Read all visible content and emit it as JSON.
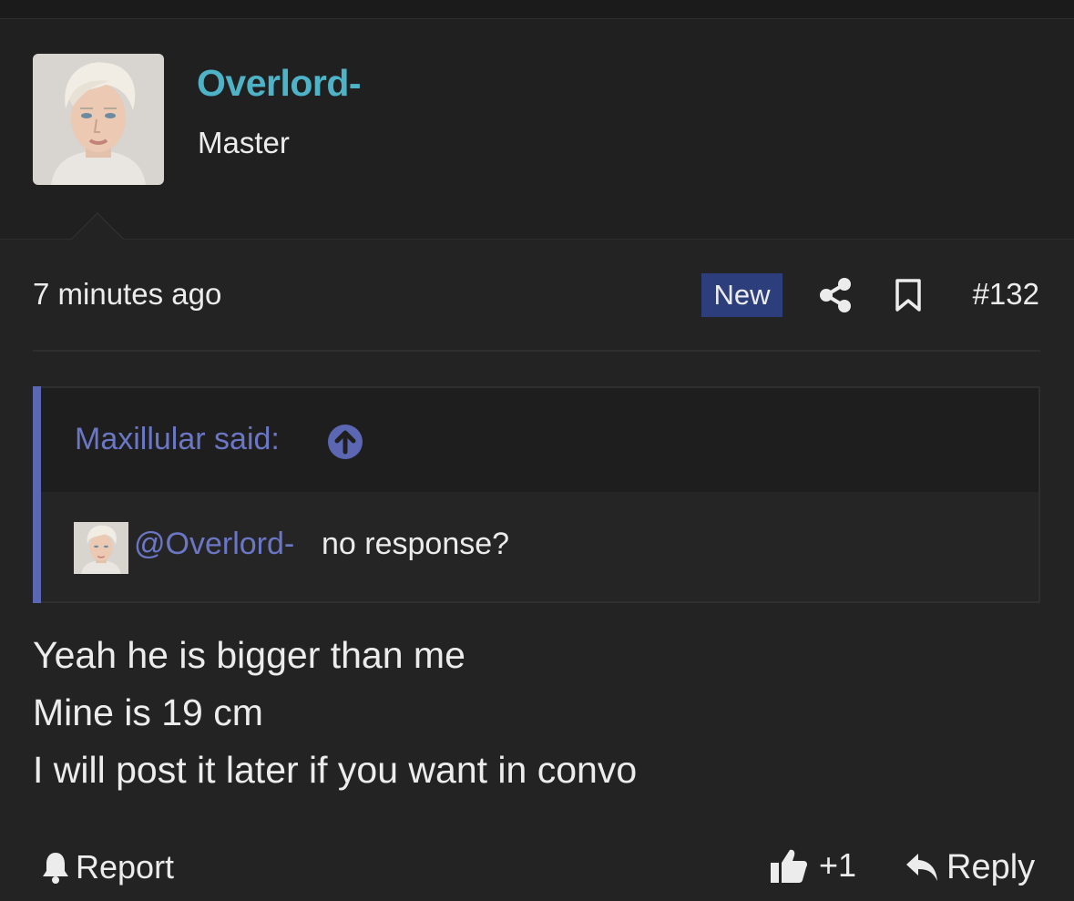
{
  "header": {
    "username": "Overlord-",
    "user_title": "Master"
  },
  "post": {
    "date": "7 minutes ago",
    "badge": "New",
    "number": "#132",
    "icons": [
      "share-icon",
      "bookmark-icon"
    ]
  },
  "quote": {
    "author": "Maxillular said:",
    "mention": "@Overlord-",
    "text": "no response?"
  },
  "message": {
    "lines": [
      "Yeah he is bigger than me",
      "Mine is 19 cm",
      "I will post it later if you want in convo"
    ]
  },
  "footer": {
    "report_label": "Report",
    "like_label": "+1",
    "reply_label": "Reply"
  },
  "colors": {
    "background": "#232324",
    "username": "#4fb3c7",
    "accent": "#6b77c4",
    "badge": "#2d3e7d"
  }
}
